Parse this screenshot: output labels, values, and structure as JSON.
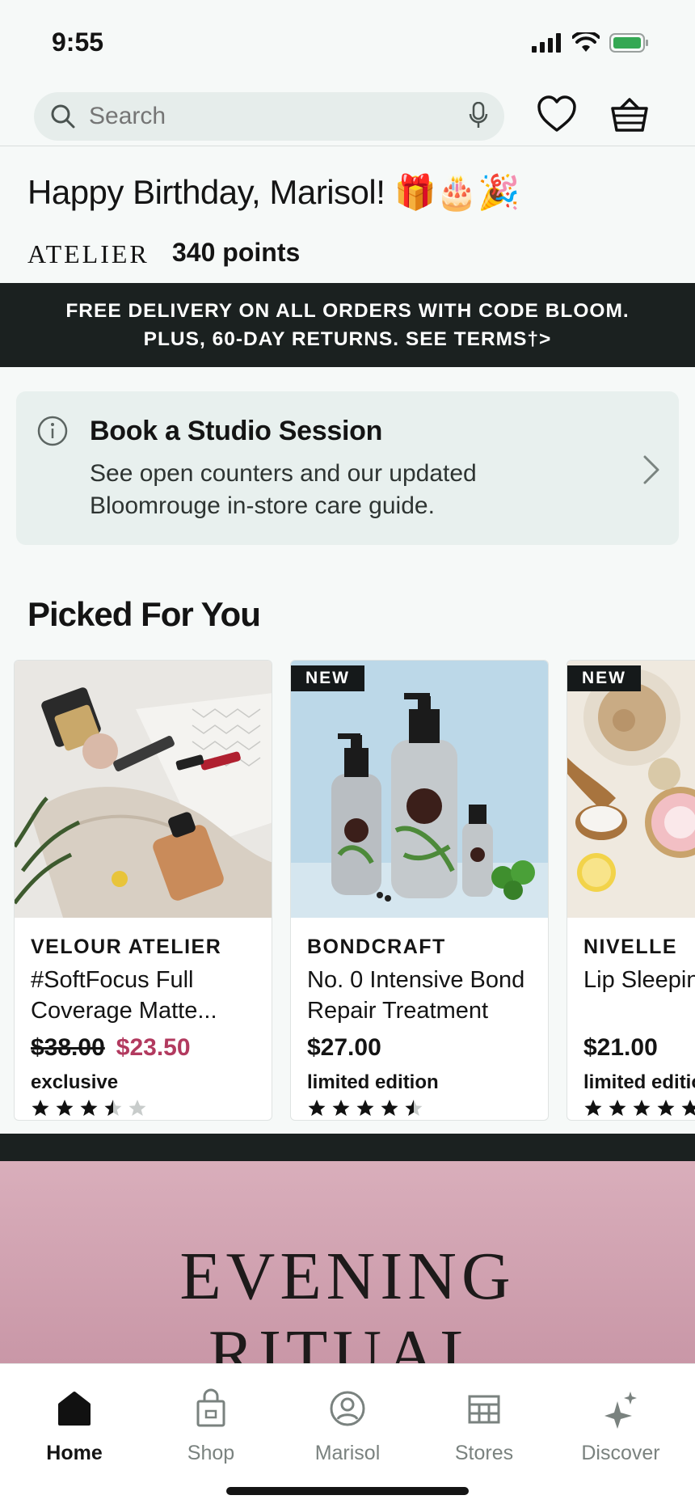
{
  "status_bar": {
    "time": "9:55"
  },
  "search": {
    "placeholder": "Search"
  },
  "greeting": {
    "text": "Happy Birthday, Marisol! 🎁🎂🎉"
  },
  "loyalty": {
    "brand": "ATELIER",
    "points": "340 points"
  },
  "promo": {
    "line1": "FREE DELIVERY ON ALL ORDERS WITH CODE BLOOM.",
    "line2": "PLUS, 60-DAY RETURNS. SEE TERMS†>"
  },
  "info_card": {
    "title": "Book a Studio Session",
    "body": "See open counters and our updated Bloomrouge in-store care guide."
  },
  "picked": {
    "title": "Picked For You",
    "products": [
      {
        "badge": "",
        "brand": "VELOUR ATELIER",
        "name_line1": "#SoftFocus Full",
        "name_line2": "Coverage Matte...",
        "old_price": "$38.00",
        "price": "$23.50",
        "tag": "exclusive",
        "rating": 3.5,
        "image": "makeup-flatlay"
      },
      {
        "badge": "NEW",
        "brand": "BONDCRAFT",
        "name_line1": "No. 0 Intensive Bond",
        "name_line2": "Repair Treatment",
        "old_price": "",
        "price": "$27.00",
        "tag": "limited edition",
        "rating": 4.5,
        "image": "hair-care-bottles"
      },
      {
        "badge": "NEW",
        "brand": "NIVELLE",
        "name_line1": "Lip Sleeping Mask",
        "name_line2": "",
        "old_price": "",
        "price": "$21.00",
        "tag": "limited edition",
        "rating": 5,
        "image": "lip-scrub-jars"
      }
    ]
  },
  "hero": {
    "line1": "EVENING",
    "line2": "RITUAL"
  },
  "tabs": [
    {
      "label": "Home",
      "icon": "home-icon",
      "active": true
    },
    {
      "label": "Shop",
      "icon": "shopping-bag-icon",
      "active": false
    },
    {
      "label": "Marisol",
      "icon": "profile-icon",
      "active": false
    },
    {
      "label": "Stores",
      "icon": "store-icon",
      "active": false
    },
    {
      "label": "Discover",
      "icon": "sparkle-icon",
      "active": false
    }
  ],
  "colors": {
    "accent_sale": "#b23a5f",
    "dark_band": "#1b2120",
    "hero_pink": "#d4a5b4"
  }
}
